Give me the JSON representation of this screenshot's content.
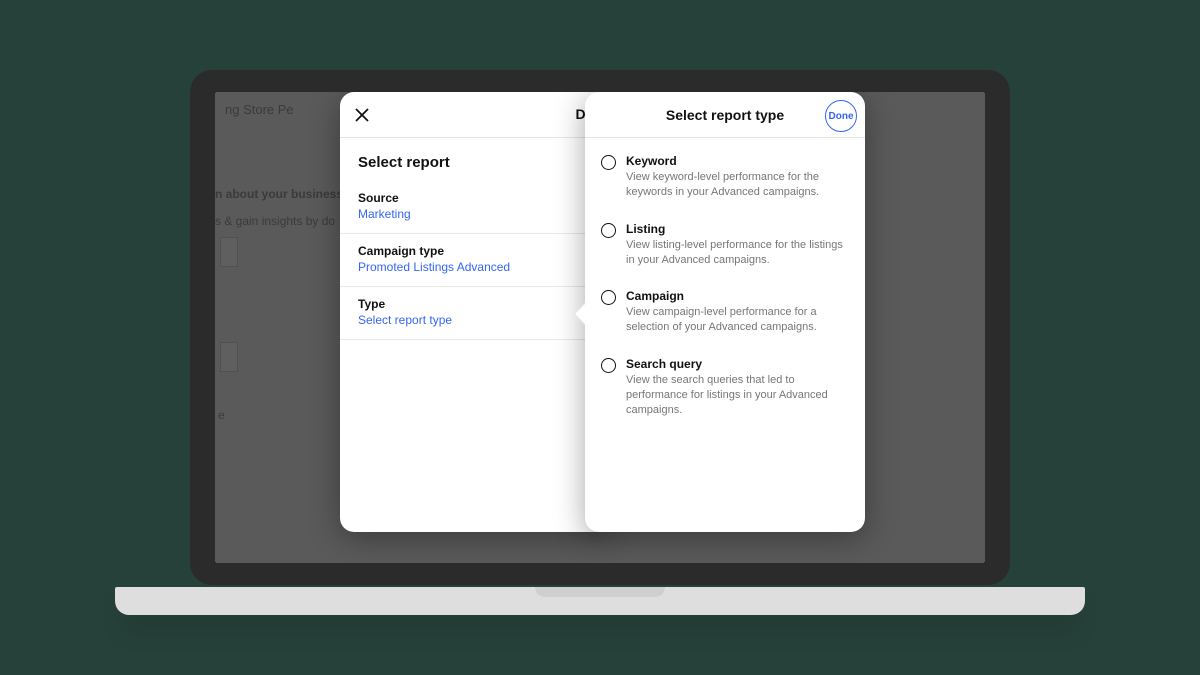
{
  "bg": {
    "nav": "ng   Store   Pe",
    "line1": "n about your business",
    "line2": "s & gain insights by do",
    "line3": "e"
  },
  "leftPanel": {
    "partialTitle": "Dov",
    "heading": "Select report",
    "rows": [
      {
        "label": "Source",
        "value": "Marketing"
      },
      {
        "label": "Campaign type",
        "value": "Promoted Listings Advanced"
      },
      {
        "label": "Type",
        "value": "Select report type"
      }
    ]
  },
  "rightPanel": {
    "title": "Select report type",
    "done": "Done",
    "options": [
      {
        "title": "Keyword",
        "desc": "View keyword-level performance for the keywords in your Advanced campaigns."
      },
      {
        "title": "Listing",
        "desc": "View listing-level performance for the listings in your Advanced campaigns."
      },
      {
        "title": "Campaign",
        "desc": "View campaign-level performance for a selection of your Advanced campaigns."
      },
      {
        "title": "Search query",
        "desc": "View the search queries that led to performance for listings in your Advanced campaigns."
      }
    ]
  }
}
